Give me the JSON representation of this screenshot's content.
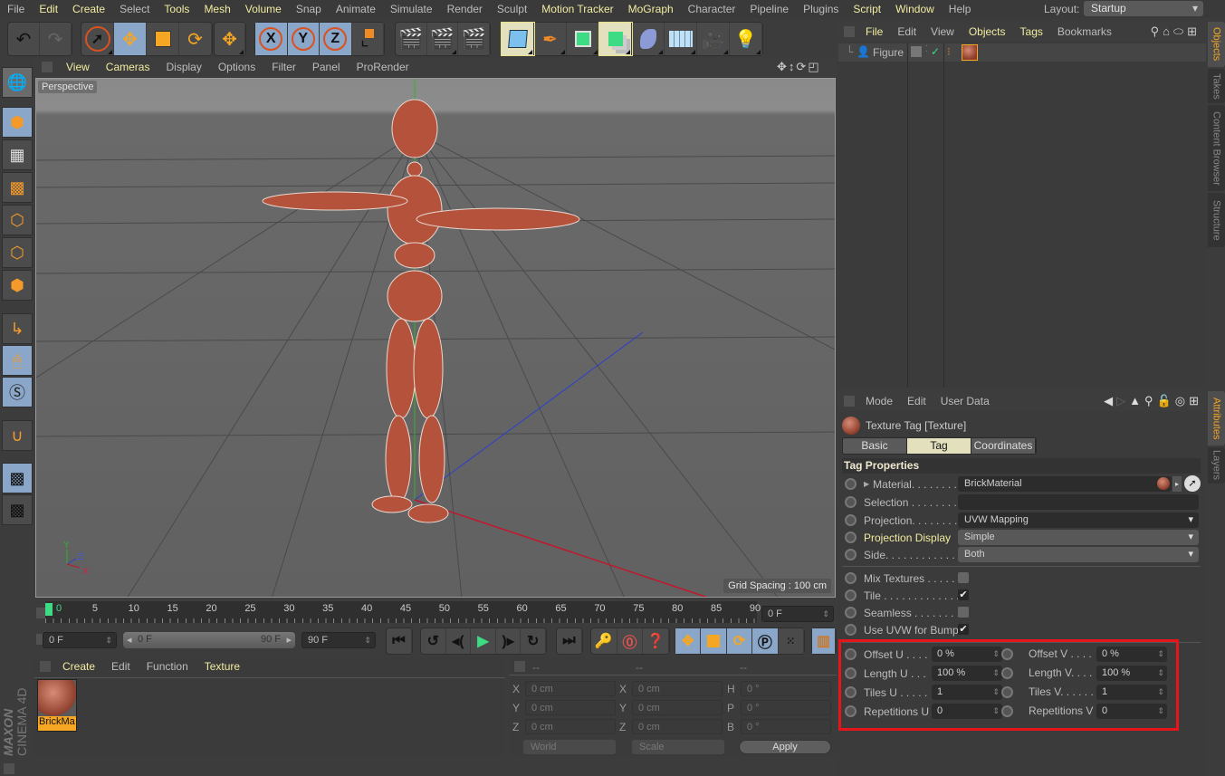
{
  "menubar": {
    "items": [
      {
        "label": "File",
        "hl": false
      },
      {
        "label": "Edit",
        "hl": true
      },
      {
        "label": "Create",
        "hl": true
      },
      {
        "label": "Select",
        "hl": false
      },
      {
        "label": "Tools",
        "hl": true
      },
      {
        "label": "Mesh",
        "hl": true
      },
      {
        "label": "Volume",
        "hl": true
      },
      {
        "label": "Snap",
        "hl": false
      },
      {
        "label": "Animate",
        "hl": false
      },
      {
        "label": "Simulate",
        "hl": false
      },
      {
        "label": "Render",
        "hl": false
      },
      {
        "label": "Sculpt",
        "hl": false
      },
      {
        "label": "Motion Tracker",
        "hl": true
      },
      {
        "label": "MoGraph",
        "hl": true
      },
      {
        "label": "Character",
        "hl": false
      },
      {
        "label": "Pipeline",
        "hl": false
      },
      {
        "label": "Plugins",
        "hl": false
      },
      {
        "label": "Script",
        "hl": true
      },
      {
        "label": "Window",
        "hl": true
      },
      {
        "label": "Help",
        "hl": false
      }
    ],
    "layout_label": "Layout:",
    "layout_value": "Startup"
  },
  "toolbar": {
    "undo": "undo-icon",
    "redo": "redo-icon",
    "axis_x": "X",
    "axis_y": "Y",
    "axis_z": "Z"
  },
  "viewport": {
    "menu": [
      {
        "label": "View",
        "hl": true
      },
      {
        "label": "Cameras",
        "hl": true
      },
      {
        "label": "Display",
        "hl": false
      },
      {
        "label": "Options",
        "hl": false
      },
      {
        "label": "Filter",
        "hl": false
      },
      {
        "label": "Panel",
        "hl": false
      },
      {
        "label": "ProRender",
        "hl": false
      }
    ],
    "camera_label": "Perspective",
    "grid_spacing": "Grid Spacing : 100 cm",
    "axis_labels": {
      "x": "X",
      "y": "Y",
      "z": "Z"
    }
  },
  "timeline": {
    "ticks": [
      "0",
      "5",
      "10",
      "15",
      "20",
      "25",
      "30",
      "35",
      "40",
      "45",
      "50",
      "55",
      "60",
      "65",
      "70",
      "75",
      "80",
      "85",
      "90"
    ],
    "current_frame": "0 F",
    "start_field": "0 F",
    "range_start": "0 F",
    "range_end": "90 F",
    "end_field": "90 F"
  },
  "material_panel": {
    "menu": [
      {
        "label": "Create",
        "hl": true
      },
      {
        "label": "Edit",
        "hl": false
      },
      {
        "label": "Function",
        "hl": false
      },
      {
        "label": "Texture",
        "hl": true
      }
    ],
    "materials": [
      {
        "name": "BrickMa"
      }
    ],
    "brand_line1": "MAXON",
    "brand_line2": "CINEMA 4D"
  },
  "coordinates": {
    "headers": [
      "--",
      "--",
      "--"
    ],
    "rows": [
      {
        "l1": "X",
        "v1": "0 cm",
        "l2": "X",
        "v2": "0 cm",
        "l3": "H",
        "v3": "0 °"
      },
      {
        "l1": "Y",
        "v1": "0 cm",
        "l2": "Y",
        "v2": "0 cm",
        "l3": "P",
        "v3": "0 °"
      },
      {
        "l1": "Z",
        "v1": "0 cm",
        "l2": "Z",
        "v2": "0 cm",
        "l3": "B",
        "v3": "0 °"
      }
    ],
    "space": "World",
    "mode": "Scale",
    "apply": "Apply"
  },
  "objects_panel": {
    "menu": [
      {
        "label": "File",
        "hl": true
      },
      {
        "label": "Edit",
        "hl": false
      },
      {
        "label": "View",
        "hl": false
      },
      {
        "label": "Objects",
        "hl": true
      },
      {
        "label": "Tags",
        "hl": true
      },
      {
        "label": "Bookmarks",
        "hl": false
      }
    ],
    "objects": [
      {
        "name": "Figure"
      }
    ]
  },
  "side_tabs_top": [
    {
      "label": "Objects",
      "active": true
    },
    {
      "label": "Takes",
      "active": false
    },
    {
      "label": "Content Browser",
      "active": false
    },
    {
      "label": "Structure",
      "active": false
    }
  ],
  "side_tabs_bottom": [
    {
      "label": "Attributes",
      "active": true
    },
    {
      "label": "Layers",
      "active": false
    }
  ],
  "attributes": {
    "menu": [
      {
        "label": "Mode"
      },
      {
        "label": "Edit"
      },
      {
        "label": "User Data"
      }
    ],
    "title": "Texture Tag [Texture]",
    "tabs": [
      {
        "label": "Basic",
        "active": false
      },
      {
        "label": "Tag",
        "active": true
      },
      {
        "label": "Coordinates",
        "active": false
      }
    ],
    "section": "Tag Properties",
    "material_label": "Material. . . . . . . .",
    "material_value": "BrickMaterial",
    "selection_label": "Selection . . . . . . . .",
    "selection_value": "",
    "projection_label": "Projection. . . . . . . .",
    "projection_value": "UVW Mapping",
    "projection_display_label": "Projection Display",
    "projection_display_value": "Simple",
    "side_label": "Side. . . . . . . . . . . .",
    "side_value": "Both",
    "mix_textures_label": "Mix Textures . . . . .",
    "mix_textures": false,
    "tile_label": "Tile . . . . . . . . . . . . .",
    "tile": true,
    "seamless_label": "Seamless . . . . . . . .",
    "seamless": false,
    "uvw_bump_label": "Use UVW for Bump",
    "uvw_bump": true,
    "uv_fields": [
      {
        "label_u": "Offset U . . . .",
        "value_u": "0 %",
        "label_v": "Offset V . . . .",
        "value_v": "0 %"
      },
      {
        "label_u": "Length U . . .",
        "value_u": "100 %",
        "label_v": "Length V. . . .",
        "value_v": "100 %"
      },
      {
        "label_u": "Tiles U . . . . .",
        "value_u": "1",
        "label_v": "Tiles V. . . . . .",
        "value_v": "1"
      },
      {
        "label_u": "Repetitions U",
        "value_u": "0",
        "label_v": "Repetitions V",
        "value_v": "0"
      }
    ],
    "highlight_color": "#e8141c"
  }
}
